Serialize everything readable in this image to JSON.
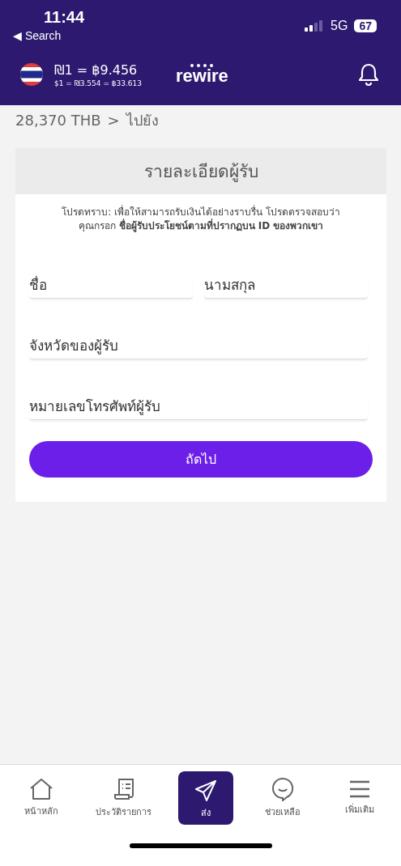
{
  "status_bar": {
    "time": "11:44",
    "back": "◀ Search",
    "network": "5G",
    "battery": "67"
  },
  "header": {
    "rate": "₪1 = ฿9.456",
    "subrate": "$1 = ₪3.554 = ฿33.613",
    "logo": "rewire"
  },
  "summary": {
    "amount": "28,370 THB",
    "arrow": ">",
    "destination": "ไปยัง"
  },
  "card": {
    "title": "รายละเอียดผู้รับ",
    "notice": [
      "โปรดทราบ: เพื่อให้สามารถรับเงินได้อย่างราบรื่น โปรดตรวจสอบว่า",
      "คุณกรอก **ชื่อผู้รับประโยชน์ตามที่ปรากฏบน ID ของพวกเขา**"
    ],
    "field_rows": [
      [
        {
          "placeholder": "ชื่อ"
        },
        {
          "placeholder": "นามสกุล"
        }
      ],
      [
        {
          "placeholder": "จังหวัดของผู้รับ"
        }
      ],
      [
        {
          "placeholder": "หมายเลขโทรศัพท์ผู้รับ"
        }
      ]
    ],
    "button": "ถัดไป"
  },
  "nav": [
    {
      "label": "หน้าหลัก",
      "kind": "home",
      "selected": false
    },
    {
      "label": "ประวัติรายการ",
      "kind": "history",
      "selected": false
    },
    {
      "label": "ส่ง",
      "kind": "send",
      "selected": true
    },
    {
      "label": "ช่วยเหลือ",
      "kind": "help",
      "selected": false
    },
    {
      "label": "เพิ่มเติม",
      "kind": "more",
      "selected": false
    }
  ]
}
